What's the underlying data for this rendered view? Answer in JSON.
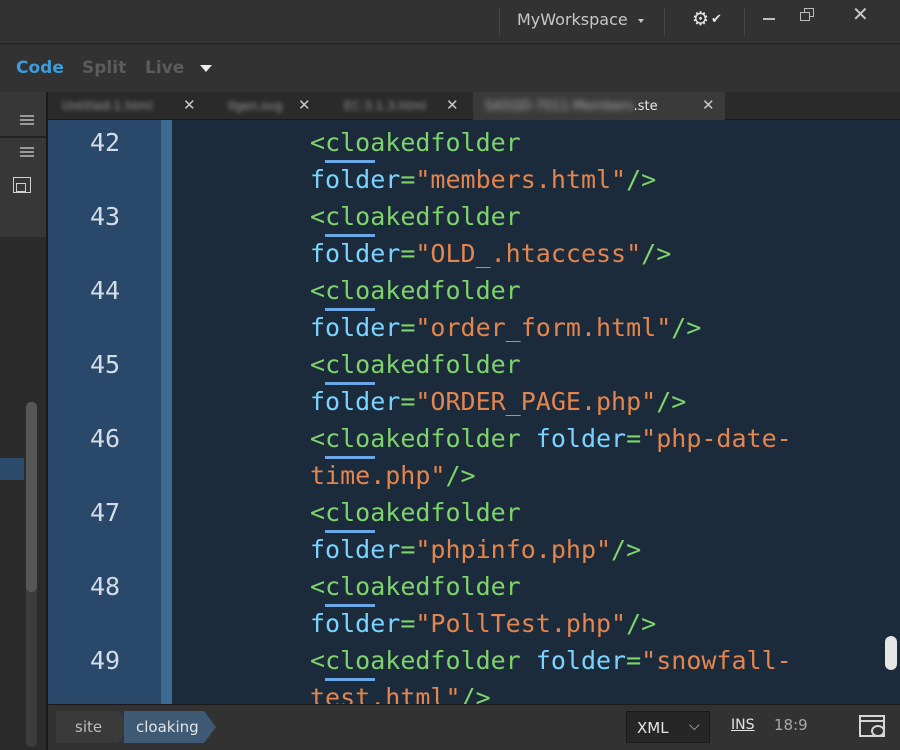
{
  "window": {
    "workspace_label": "MyWorkspace",
    "icons": [
      "gear-icon",
      "check-icon",
      "minimize-icon",
      "restore-icon",
      "close-icon"
    ]
  },
  "view_bar": {
    "code": "Code",
    "split": "Split",
    "live": "Live"
  },
  "tabs": [
    {
      "label": "Untitled-1.html",
      "active": false
    },
    {
      "label": "Ilgen.svg",
      "active": false
    },
    {
      "label": "EC-3.1.3.html",
      "active": false
    },
    {
      "label": "SA5QD-7011-Members",
      "suffix": ".ste",
      "active": true
    }
  ],
  "code_lines": [
    {
      "num": "42",
      "tag": "cloakedfolder",
      "attr": "folder",
      "value": "\"members.html\"",
      "wrap": true,
      "value2": ""
    },
    {
      "num": "43",
      "tag": "cloakedfolder",
      "attr": "folder",
      "value": "\"OLD_.htaccess\"",
      "wrap": true,
      "value2": ""
    },
    {
      "num": "44",
      "tag": "cloakedfolder",
      "attr": "folder",
      "value": "\"order_form.html\"",
      "wrap": true,
      "value2": ""
    },
    {
      "num": "45",
      "tag": "cloakedfolder",
      "attr": "folder",
      "value": "\"ORDER_PAGE.php\"",
      "wrap": true,
      "value2": ""
    },
    {
      "num": "46",
      "tag": "cloakedfolder",
      "attr": "folder",
      "value": "\"php-date-",
      "wrap": false,
      "value2": "time.php\""
    },
    {
      "num": "47",
      "tag": "cloakedfolder",
      "attr": "folder",
      "value": "\"phpinfo.php\"",
      "wrap": true,
      "value2": ""
    },
    {
      "num": "48",
      "tag": "cloakedfolder",
      "attr": "folder",
      "value": "\"PollTest.php\"",
      "wrap": true,
      "value2": ""
    },
    {
      "num": "49",
      "tag": "cloakedfolder",
      "attr": "folder",
      "value": "\"snowfall-",
      "wrap": false,
      "value2": "test.html\""
    }
  ],
  "status": {
    "crumb_site": "site",
    "crumb_current": "cloaking",
    "language": "XML",
    "ins": "INS",
    "cursor": "18:9"
  },
  "colors": {
    "tag": "#7ed36a",
    "attr": "#7ad4ff",
    "string": "#e3854d",
    "accent": "#3d9bdc"
  }
}
